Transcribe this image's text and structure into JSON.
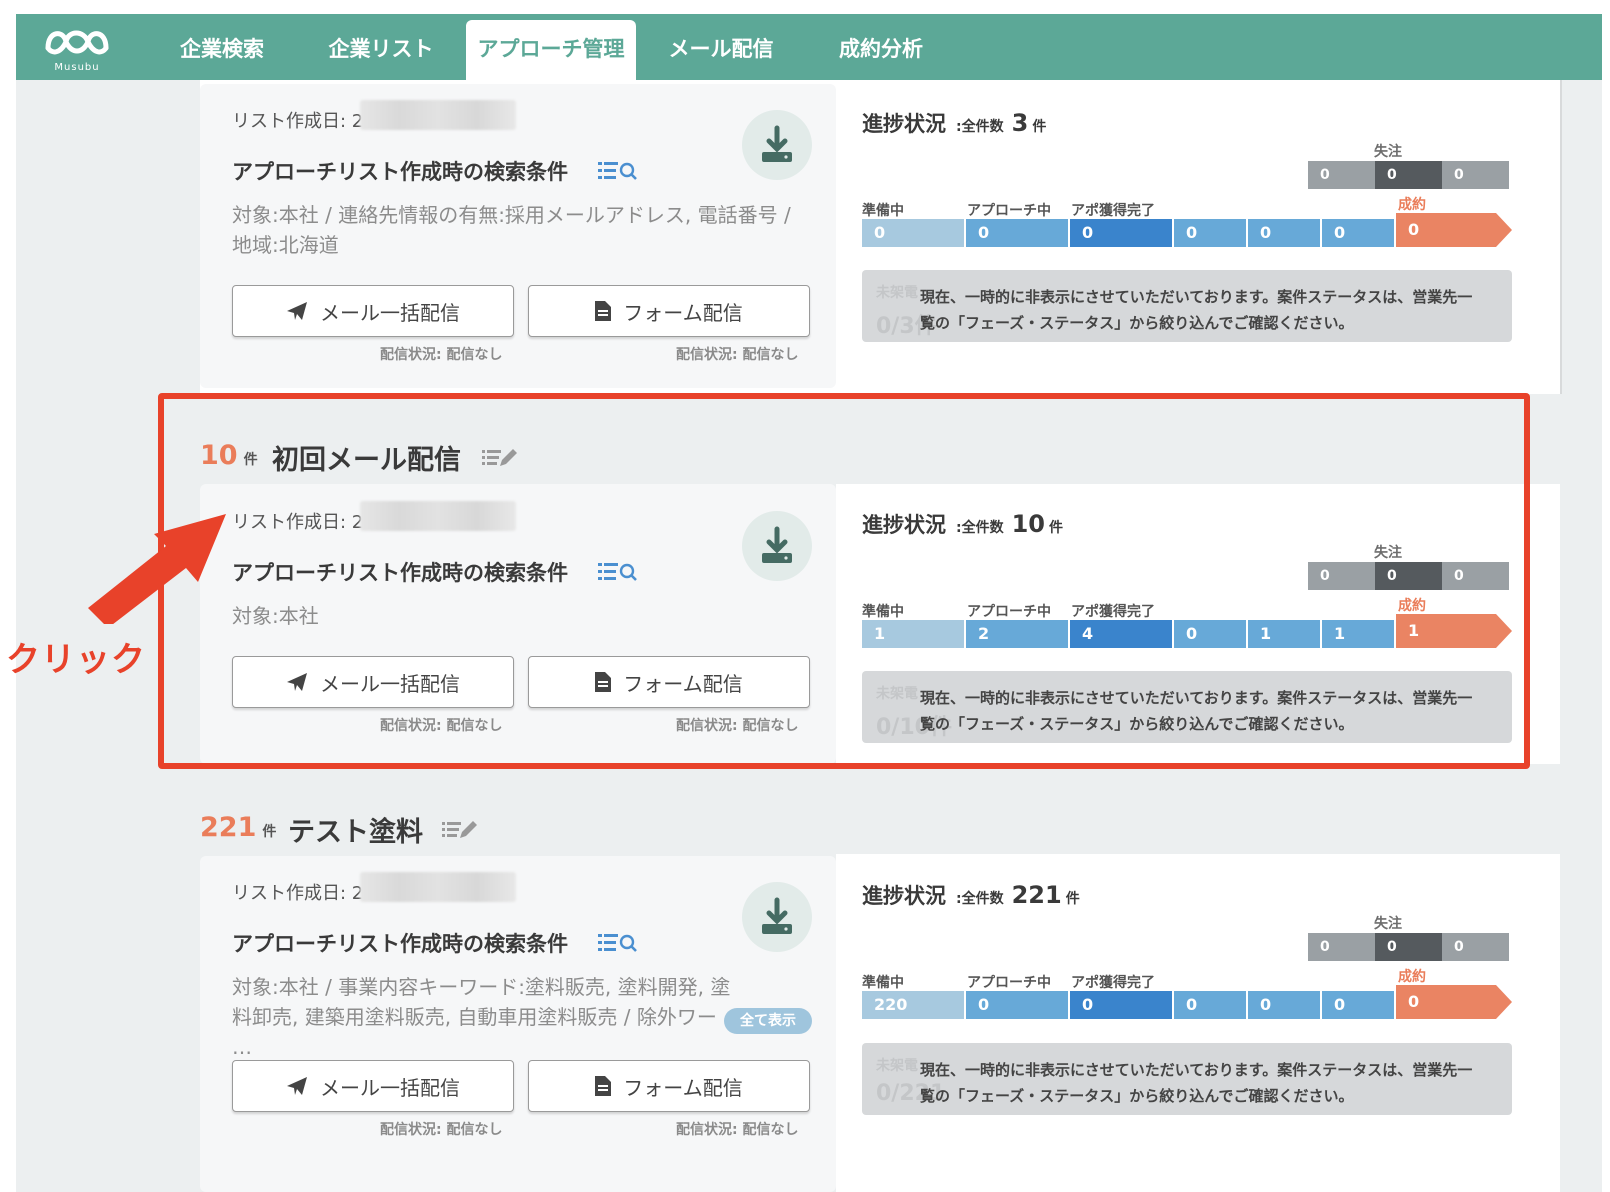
{
  "app": {
    "logo_text": "Musubu"
  },
  "nav": {
    "tabs": [
      {
        "label": "企業検索"
      },
      {
        "label": "企業リスト"
      },
      {
        "label": "アプローチ管理",
        "active": true
      },
      {
        "label": "メール配信"
      },
      {
        "label": "成約分析"
      }
    ]
  },
  "common": {
    "created_label": "リスト作成日: 2",
    "cond_title": "アプローチリスト作成時の検索条件",
    "mail_button": "メール一括配信",
    "form_button": "フォーム配信",
    "delivery_status": "配信状況: 配信なし",
    "progress_label": "進捗状況",
    "total_label": ":全件数",
    "count_unit": "件",
    "lost_label": "失注",
    "stage_labels": [
      "準備中",
      "アプローチ中",
      "アポ獲得完了"
    ],
    "won_label": "成約",
    "notice_text": "現在、一時的に非表示にさせていただいております。案件ステータスは、営業先一覧の「フェーズ・ステータス」から絞り込んでご確認ください。",
    "notice_ghost_label": "未架電",
    "show_all": "全て表示"
  },
  "groups": [
    {
      "conditions": "対象:本社 / 連絡先情報の有無:採用メールアドレス, 電話番号 / 地域:北海道",
      "total": "3",
      "lost": [
        "0",
        "0",
        "0"
      ],
      "stages": [
        "0",
        "0",
        "0",
        "0",
        "0",
        "0"
      ],
      "won": "0",
      "ghost": "0/3件"
    },
    {
      "count": "10",
      "title": "初回メール配信",
      "conditions": "対象:本社",
      "total": "10",
      "lost": [
        "0",
        "0",
        "0"
      ],
      "stages": [
        "1",
        "2",
        "4",
        "0",
        "1",
        "1"
      ],
      "won": "1",
      "ghost": "0/10件"
    },
    {
      "count": "221",
      "title": "テスト塗料",
      "conditions": "対象:本社 / 事業内容キーワード:塗料販売, 塗料開発, 塗料卸売, 建築用塗料販売, 自動車用塗料販売 / 除外ワー …",
      "total": "221",
      "lost": [
        "0",
        "0",
        "0"
      ],
      "stages": [
        "220",
        "0",
        "0",
        "0",
        "0",
        "0"
      ],
      "won": "0",
      "ghost": "0/221"
    }
  ],
  "annotation": {
    "click_label": "クリック"
  },
  "colors": {
    "brand": "#5ca897",
    "accent": "#ea7d5a",
    "highlight": "#e8422a"
  }
}
